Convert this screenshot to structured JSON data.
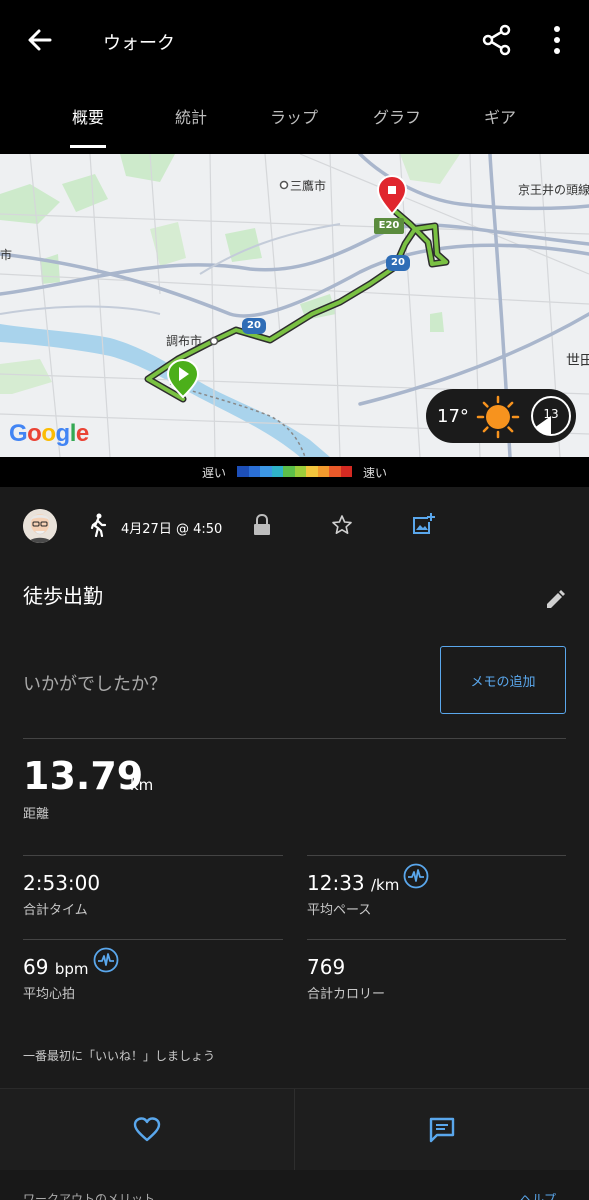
{
  "header": {
    "back_icon": "arrow-left-icon",
    "title": "ウォーク",
    "share_icon": "share-icon",
    "more_icon": "more-vert-icon"
  },
  "tabs": [
    {
      "label": "概要",
      "active": true
    },
    {
      "label": "統計",
      "active": false
    },
    {
      "label": "ラップ",
      "active": false
    },
    {
      "label": "グラフ",
      "active": false
    },
    {
      "label": "ギア",
      "active": false
    }
  ],
  "map": {
    "labels": {
      "city1": "三鷹市",
      "city2": "京王井の頭線",
      "city3": "調布市",
      "city4": "世田",
      "city5": "市",
      "road_e20": "E20",
      "road_20a": "20",
      "road_20b": "20"
    },
    "attribution": "Google",
    "weather": {
      "temperature": "17°",
      "condition_icon": "sun-icon",
      "moon_value": "13"
    }
  },
  "pace_legend": {
    "slow_label": "遅い",
    "fast_label": "速い",
    "colors": [
      "#1d4fb8",
      "#2b6fd6",
      "#3d98e6",
      "#2fb3c9",
      "#5cbf4a",
      "#9ccd3b",
      "#f2c53d",
      "#f29a2e",
      "#ea5a2a",
      "#d42a22"
    ]
  },
  "activity": {
    "avatar_icon": "avatar-icon",
    "type_icon": "walking-icon",
    "datetime": "4月27日 @ 4:50",
    "title": "徒歩出勤",
    "prompt": "いかがでしたか？",
    "add_memo_label": "メモの追加"
  },
  "stats": {
    "distance": {
      "value": "13.79",
      "unit": "km",
      "label": "距離"
    },
    "total_time": {
      "value": "2:53:00",
      "label": "合計タイム"
    },
    "avg_pace": {
      "value": "12:33",
      "unit": "/km",
      "label": "平均ペース"
    },
    "avg_hr": {
      "value": "69",
      "unit": "bpm",
      "label": "平均心拍"
    },
    "calories": {
      "value": "769",
      "label": "合計カロリー"
    }
  },
  "social": {
    "like_prompt": "一番最初に「いいね！」しましょう",
    "like_icon": "heart-icon",
    "comment_icon": "comment-icon"
  },
  "footer_peek": {
    "left": "ワークアウトのメリット",
    "right": "ヘルプ"
  },
  "colors": {
    "accent": "#5aa7ec",
    "background": "#1b1b1b",
    "route": "#7ac143",
    "start_marker": "#4caf1a",
    "end_marker": "#e0262e"
  }
}
